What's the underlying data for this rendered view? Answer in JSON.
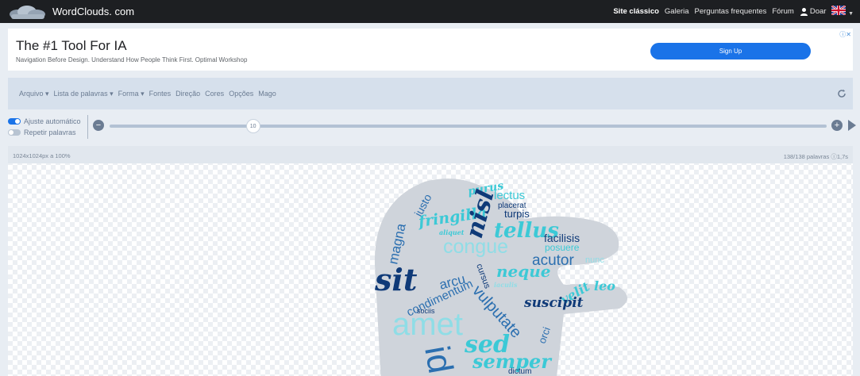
{
  "nav": {
    "brand": "WordClouds. com",
    "classic": "Site clássico",
    "gallery": "Galeria",
    "faq": "Perguntas frequentes",
    "forum": "Fórum",
    "donate": "Doar",
    "language_flag": "uk-flag-icon"
  },
  "ad": {
    "title": "The #1 Tool For IA",
    "subtitle": "Navigation Before Design. Understand How People Think First. Optimal Workshop",
    "button": "Sign Up",
    "choices": "ⓘ✕"
  },
  "menu": {
    "items": [
      "Arquivo ▾",
      "Lista de palavras ▾",
      "Forma ▾",
      "Fontes",
      "Direção",
      "Cores",
      "Opções",
      "Mago"
    ]
  },
  "controls": {
    "autofit_label": "Ajuste automático",
    "autofit_on": true,
    "repeat_label": "Repetir palavras",
    "repeat_on": false,
    "slider_value": "10",
    "slider_fraction": 0.2
  },
  "canvas": {
    "size_info": "1024x1024px a 100%",
    "word_count": "138/138 palavras ⓘ1,7s"
  },
  "wordcloud": {
    "colors": {
      "dark": "#0f3a78",
      "mid": "#2b6fb0",
      "teal": "#3cc9d6",
      "light": "#8fdde6",
      "shape": "#c9ced6"
    },
    "words": [
      {
        "text": "purus",
        "color": "teal"
      },
      {
        "text": "lectus",
        "color": "teal"
      },
      {
        "text": "justo",
        "color": "mid"
      },
      {
        "text": "placerat",
        "color": "dark"
      },
      {
        "text": "turpis",
        "color": "dark"
      },
      {
        "text": "fringilla",
        "color": "teal"
      },
      {
        "text": "nisl",
        "color": "dark"
      },
      {
        "text": "tellus",
        "color": "teal"
      },
      {
        "text": "aliquet",
        "color": "teal"
      },
      {
        "text": "magna",
        "color": "mid"
      },
      {
        "text": "congue",
        "color": "light"
      },
      {
        "text": "facilisis",
        "color": "dark"
      },
      {
        "text": "posuere",
        "color": "teal"
      },
      {
        "text": "acutor",
        "color": "mid"
      },
      {
        "text": "nunc",
        "color": "light"
      },
      {
        "text": "sit",
        "color": "dark"
      },
      {
        "text": "condimentum",
        "color": "mid"
      },
      {
        "text": "arcu",
        "color": "mid"
      },
      {
        "text": "cursus",
        "color": "dark"
      },
      {
        "text": "neque",
        "color": "teal"
      },
      {
        "text": "iaculis",
        "color": "light"
      },
      {
        "text": "velit",
        "color": "teal"
      },
      {
        "text": "leo",
        "color": "teal"
      },
      {
        "text": "suscipit",
        "color": "dark"
      },
      {
        "text": "sociis",
        "color": "dark"
      },
      {
        "text": "vulputate",
        "color": "mid"
      },
      {
        "text": "amet",
        "color": "teal"
      },
      {
        "text": "orci",
        "color": "mid"
      },
      {
        "text": "id",
        "color": "mid"
      },
      {
        "text": "sed",
        "color": "teal"
      },
      {
        "text": "semper",
        "color": "teal"
      },
      {
        "text": "dictum",
        "color": "dark"
      }
    ]
  }
}
